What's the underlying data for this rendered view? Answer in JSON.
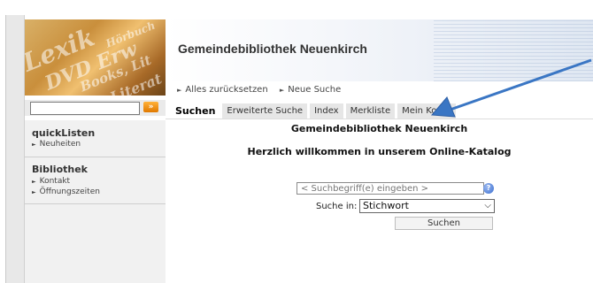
{
  "header": {
    "logo_words": [
      "Lexik",
      "DVD Erw",
      "Books, Lit",
      "Hörbuch",
      "Literat"
    ],
    "title": "Gemeindebibliothek Neuenkirch"
  },
  "actions": [
    {
      "label": "Alles zurücksetzen"
    },
    {
      "label": "Neue Suche"
    }
  ],
  "tabs": [
    {
      "label": "Suchen",
      "active": true
    },
    {
      "label": "Erweiterte Suche"
    },
    {
      "label": "Index"
    },
    {
      "label": "Merkliste"
    },
    {
      "label": "Mein Konto"
    }
  ],
  "quicksearch": {
    "value": "",
    "button_label": "»"
  },
  "sidebar": {
    "sections": [
      {
        "title": "quickListen",
        "items": [
          {
            "label": "Neuheiten"
          }
        ]
      },
      {
        "title": "Bibliothek",
        "items": [
          {
            "label": "Kontakt"
          },
          {
            "label": "Öffnungszeiten"
          }
        ]
      }
    ]
  },
  "main": {
    "title": "Gemeindebibliothek Neuenkirch",
    "welcome": "Herzlich willkommen in unserem Online-Katalog",
    "search_placeholder": "< Suchbegriff(e) eingeben >",
    "search_in_label": "Suche in:",
    "search_in_value": "Stichwort",
    "search_button": "Suchen",
    "help_icon": "?"
  },
  "colors": {
    "annotation_arrow": "#3a76c4",
    "quick_go": "#f08a00"
  }
}
